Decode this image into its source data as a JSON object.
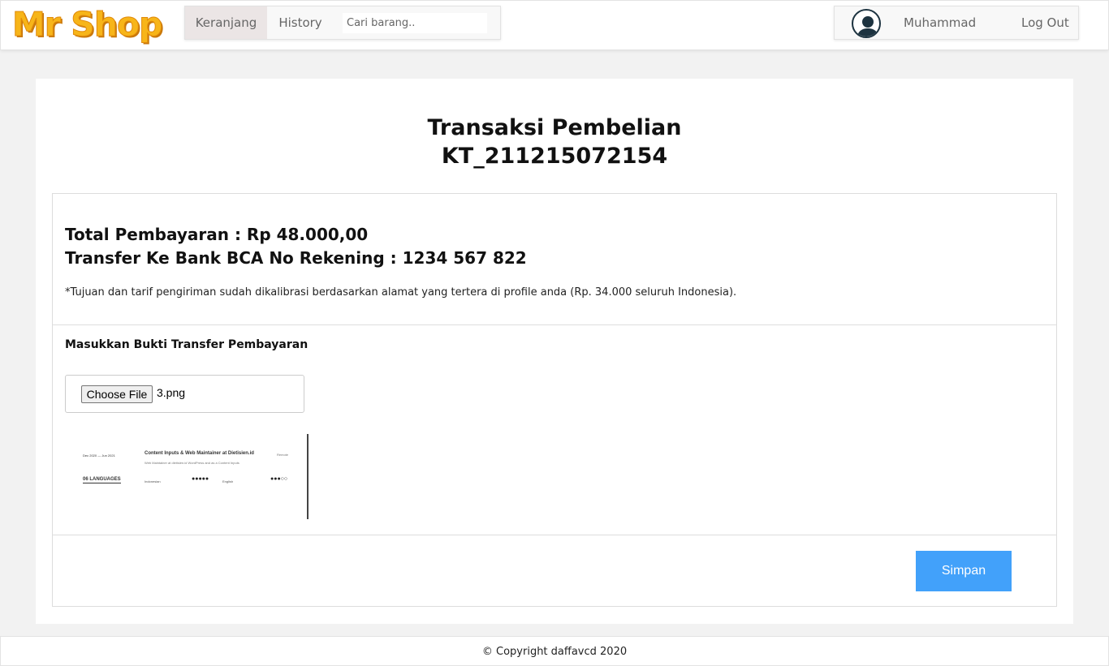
{
  "brand": {
    "logo_text": "Mr Shop",
    "logo_color": "#f7b519"
  },
  "nav": {
    "tabs": [
      {
        "label": "Keranjang",
        "active": true
      },
      {
        "label": "History",
        "active": false
      }
    ],
    "search": {
      "placeholder": "Cari barang..",
      "value": ""
    },
    "user": {
      "avatar_icon": "user-silhouette-icon",
      "name": "Muhammad"
    },
    "logout_label": "Log Out"
  },
  "main": {
    "title_line1": "Transaksi Pembelian",
    "title_line2": "KT_211215072154",
    "total_payment": "Total Pembayaran : Rp 48.000,00",
    "bank_transfer": "Transfer Ke Bank BCA No Rekening : 1234 567 822",
    "note": "*Tujuan dan tarif pengiriman sudah dikalibrasi berdasarkan alamat yang tertera di profile anda (Rp. 34.000 seluruh Indonesia).",
    "upload_label": "Masukkan Bukti Transfer Pembayaran",
    "file_input": {
      "button_label": "Choose File",
      "file_name": "3.png"
    },
    "preview": {
      "date_range": "Dec 2020 — Jun 2021",
      "role": "Content Inputs & Web Maintainer at Dietisien.id",
      "description": "Web Maintainer at dietisien.id WordPress and as a Content Inputs",
      "location": "Remote",
      "section": "06  LANGUAGES",
      "languages": [
        {
          "name": "Indonesian",
          "dots": "●●●●●"
        },
        {
          "name": "English",
          "dots": "●●●○○"
        }
      ]
    },
    "save_label": "Simpan",
    "save_color": "#42a1fa"
  },
  "footer": {
    "copyright": "© Copyright daffavcd 2020"
  }
}
